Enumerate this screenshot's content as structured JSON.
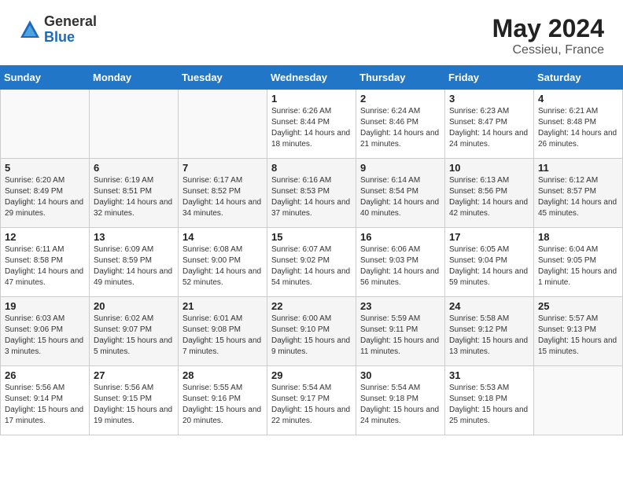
{
  "header": {
    "logo_general": "General",
    "logo_blue": "Blue",
    "month_year": "May 2024",
    "location": "Cessieu, France"
  },
  "days_of_week": [
    "Sunday",
    "Monday",
    "Tuesday",
    "Wednesday",
    "Thursday",
    "Friday",
    "Saturday"
  ],
  "weeks": [
    [
      {
        "day": "",
        "empty": true
      },
      {
        "day": "",
        "empty": true
      },
      {
        "day": "",
        "empty": true
      },
      {
        "day": "1",
        "sunrise": "6:26 AM",
        "sunset": "8:44 PM",
        "daylight": "14 hours and 18 minutes."
      },
      {
        "day": "2",
        "sunrise": "6:24 AM",
        "sunset": "8:46 PM",
        "daylight": "14 hours and 21 minutes."
      },
      {
        "day": "3",
        "sunrise": "6:23 AM",
        "sunset": "8:47 PM",
        "daylight": "14 hours and 24 minutes."
      },
      {
        "day": "4",
        "sunrise": "6:21 AM",
        "sunset": "8:48 PM",
        "daylight": "14 hours and 26 minutes."
      }
    ],
    [
      {
        "day": "5",
        "sunrise": "6:20 AM",
        "sunset": "8:49 PM",
        "daylight": "14 hours and 29 minutes."
      },
      {
        "day": "6",
        "sunrise": "6:19 AM",
        "sunset": "8:51 PM",
        "daylight": "14 hours and 32 minutes."
      },
      {
        "day": "7",
        "sunrise": "6:17 AM",
        "sunset": "8:52 PM",
        "daylight": "14 hours and 34 minutes."
      },
      {
        "day": "8",
        "sunrise": "6:16 AM",
        "sunset": "8:53 PM",
        "daylight": "14 hours and 37 minutes."
      },
      {
        "day": "9",
        "sunrise": "6:14 AM",
        "sunset": "8:54 PM",
        "daylight": "14 hours and 40 minutes."
      },
      {
        "day": "10",
        "sunrise": "6:13 AM",
        "sunset": "8:56 PM",
        "daylight": "14 hours and 42 minutes."
      },
      {
        "day": "11",
        "sunrise": "6:12 AM",
        "sunset": "8:57 PM",
        "daylight": "14 hours and 45 minutes."
      }
    ],
    [
      {
        "day": "12",
        "sunrise": "6:11 AM",
        "sunset": "8:58 PM",
        "daylight": "14 hours and 47 minutes."
      },
      {
        "day": "13",
        "sunrise": "6:09 AM",
        "sunset": "8:59 PM",
        "daylight": "14 hours and 49 minutes."
      },
      {
        "day": "14",
        "sunrise": "6:08 AM",
        "sunset": "9:00 PM",
        "daylight": "14 hours and 52 minutes."
      },
      {
        "day": "15",
        "sunrise": "6:07 AM",
        "sunset": "9:02 PM",
        "daylight": "14 hours and 54 minutes."
      },
      {
        "day": "16",
        "sunrise": "6:06 AM",
        "sunset": "9:03 PM",
        "daylight": "14 hours and 56 minutes."
      },
      {
        "day": "17",
        "sunrise": "6:05 AM",
        "sunset": "9:04 PM",
        "daylight": "14 hours and 59 minutes."
      },
      {
        "day": "18",
        "sunrise": "6:04 AM",
        "sunset": "9:05 PM",
        "daylight": "15 hours and 1 minute."
      }
    ],
    [
      {
        "day": "19",
        "sunrise": "6:03 AM",
        "sunset": "9:06 PM",
        "daylight": "15 hours and 3 minutes."
      },
      {
        "day": "20",
        "sunrise": "6:02 AM",
        "sunset": "9:07 PM",
        "daylight": "15 hours and 5 minutes."
      },
      {
        "day": "21",
        "sunrise": "6:01 AM",
        "sunset": "9:08 PM",
        "daylight": "15 hours and 7 minutes."
      },
      {
        "day": "22",
        "sunrise": "6:00 AM",
        "sunset": "9:10 PM",
        "daylight": "15 hours and 9 minutes."
      },
      {
        "day": "23",
        "sunrise": "5:59 AM",
        "sunset": "9:11 PM",
        "daylight": "15 hours and 11 minutes."
      },
      {
        "day": "24",
        "sunrise": "5:58 AM",
        "sunset": "9:12 PM",
        "daylight": "15 hours and 13 minutes."
      },
      {
        "day": "25",
        "sunrise": "5:57 AM",
        "sunset": "9:13 PM",
        "daylight": "15 hours and 15 minutes."
      }
    ],
    [
      {
        "day": "26",
        "sunrise": "5:56 AM",
        "sunset": "9:14 PM",
        "daylight": "15 hours and 17 minutes."
      },
      {
        "day": "27",
        "sunrise": "5:56 AM",
        "sunset": "9:15 PM",
        "daylight": "15 hours and 19 minutes."
      },
      {
        "day": "28",
        "sunrise": "5:55 AM",
        "sunset": "9:16 PM",
        "daylight": "15 hours and 20 minutes."
      },
      {
        "day": "29",
        "sunrise": "5:54 AM",
        "sunset": "9:17 PM",
        "daylight": "15 hours and 22 minutes."
      },
      {
        "day": "30",
        "sunrise": "5:54 AM",
        "sunset": "9:18 PM",
        "daylight": "15 hours and 24 minutes."
      },
      {
        "day": "31",
        "sunrise": "5:53 AM",
        "sunset": "9:18 PM",
        "daylight": "15 hours and 25 minutes."
      },
      {
        "day": "",
        "empty": true
      }
    ]
  ]
}
